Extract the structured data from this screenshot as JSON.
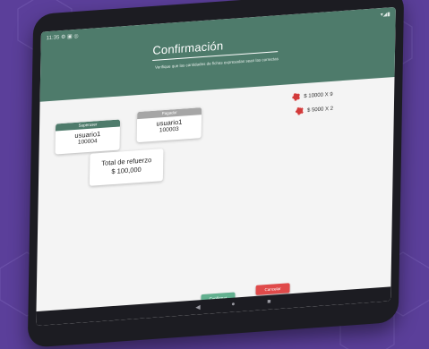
{
  "status_bar": {
    "left": "11:35 ⚙ ▣ ◎",
    "right": "▾◢▮"
  },
  "header": {
    "title": "Confirmación",
    "subtitle": "Verifique que las cantidades de fichas expresadas sean las correctas"
  },
  "cards": {
    "superuser": {
      "role": "Superuser",
      "name": "usuario1",
      "id": "100004"
    },
    "payer": {
      "role": "Pagador",
      "name": "usuario1",
      "id": "100003"
    }
  },
  "total": {
    "label": "Total de refuerzo",
    "value": "$ 100,000"
  },
  "chips": [
    {
      "icon": "poker-chip-icon",
      "text": "$ 10000 X 9"
    },
    {
      "icon": "poker-chip-icon",
      "text": "$ 5000 X 2"
    }
  ],
  "actions": {
    "confirm_label": "Confirmar",
    "cancel_label": "Cancelar"
  },
  "nav_icons": {
    "back": "back-icon",
    "home": "home-icon",
    "recents": "recents-icon"
  },
  "colors": {
    "background": "#5b3f9a",
    "appbar": "#4e7b6b",
    "superuser_header": "#4e7b6b",
    "payer_header": "#a6a6a6",
    "confirm": "#62b08f",
    "cancel": "#e04a4a",
    "chip": "#d23a3a"
  }
}
